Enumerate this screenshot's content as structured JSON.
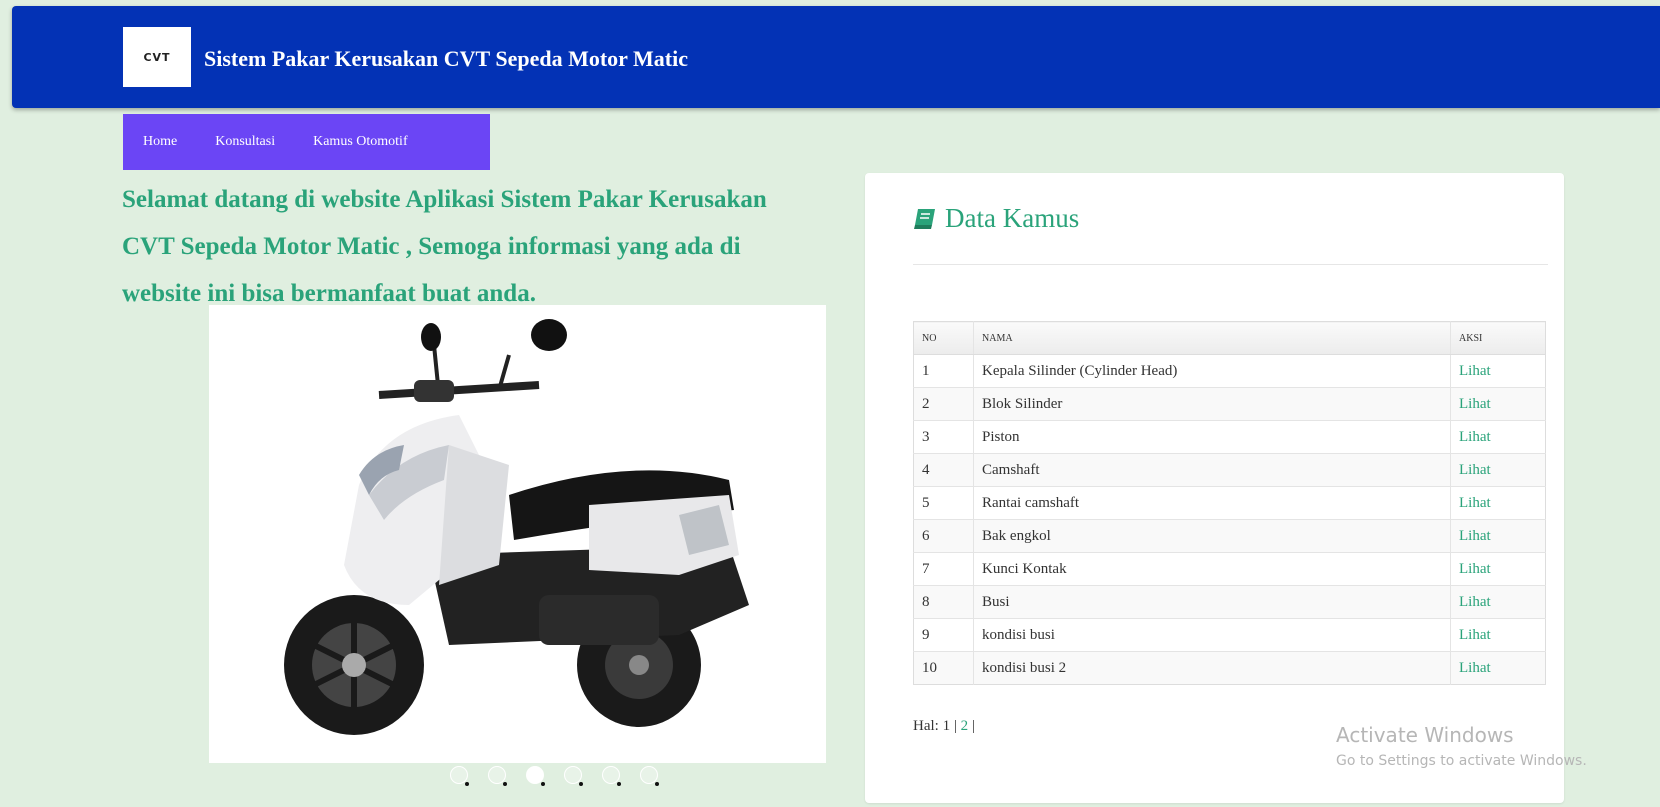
{
  "header": {
    "logo_text": "CVT",
    "title": "Sistem Pakar Kerusakan CVT Sepeda Motor Matic"
  },
  "nav": {
    "items": [
      "Home",
      "Konsultasi",
      "Kamus Otomotif"
    ]
  },
  "welcome": {
    "text": "Selamat datang di website Aplikasi Sistem Pakar Kerusakan CVT Sepeda Motor Matic , Semoga informasi yang ada di website ini bisa bermanfaat buat anda."
  },
  "carousel": {
    "slide_count": 6,
    "active_index": 2
  },
  "panel": {
    "title": "Data Kamus",
    "icon": "book-icon",
    "headers": [
      "NO",
      "NAMA",
      "AKSI"
    ],
    "rows": [
      {
        "no": "1",
        "nama": "Kepala Silinder (Cylinder Head)",
        "aksi": "Lihat"
      },
      {
        "no": "2",
        "nama": "Blok Silinder",
        "aksi": "Lihat"
      },
      {
        "no": "3",
        "nama": "Piston",
        "aksi": "Lihat"
      },
      {
        "no": "4",
        "nama": "Camshaft",
        "aksi": "Lihat"
      },
      {
        "no": "5",
        "nama": "Rantai camshaft",
        "aksi": "Lihat"
      },
      {
        "no": "6",
        "nama": "Bak engkol",
        "aksi": "Lihat"
      },
      {
        "no": "7",
        "nama": "Kunci Kontak",
        "aksi": "Lihat"
      },
      {
        "no": "8",
        "nama": "Busi",
        "aksi": "Lihat"
      },
      {
        "no": "9",
        "nama": "kondisi busi",
        "aksi": "Lihat"
      },
      {
        "no": "10",
        "nama": "kondisi busi 2",
        "aksi": "Lihat"
      }
    ]
  },
  "pager": {
    "label": "Hal:",
    "current": "1",
    "separator": "|",
    "pages": [
      "2"
    ]
  },
  "watermark": {
    "line1": "Activate Windows",
    "line2": "Go to Settings to activate Windows."
  },
  "colors": {
    "header_bg": "#0332b5",
    "nav_bg": "#6b45f5",
    "accent": "#2aa37a",
    "page_bg": "#e0efe0"
  }
}
